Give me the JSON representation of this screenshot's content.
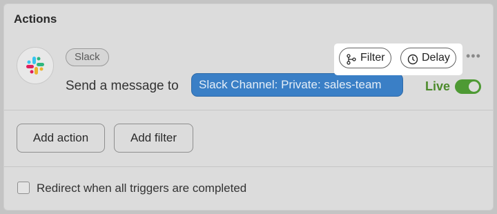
{
  "actions": {
    "title": "Actions",
    "app": {
      "name": "Slack",
      "icon": "slack-logo-icon"
    },
    "step": {
      "text": "Send a message to",
      "channel": "Slack Channel: Private: sales-team"
    },
    "toolbar": {
      "filter_label": "Filter",
      "delay_label": "Delay",
      "more_icon": "more-horizontal-icon"
    },
    "status": {
      "label": "Live",
      "enabled": true,
      "color": "#4e9a34"
    },
    "buttons": {
      "add_action": "Add action",
      "add_filter": "Add filter"
    },
    "redirect": {
      "label": "Redirect when all triggers are completed",
      "checked": false
    }
  },
  "colors": {
    "channel_pill": "#3a7fc6",
    "live_green": "#4c8a2b"
  }
}
